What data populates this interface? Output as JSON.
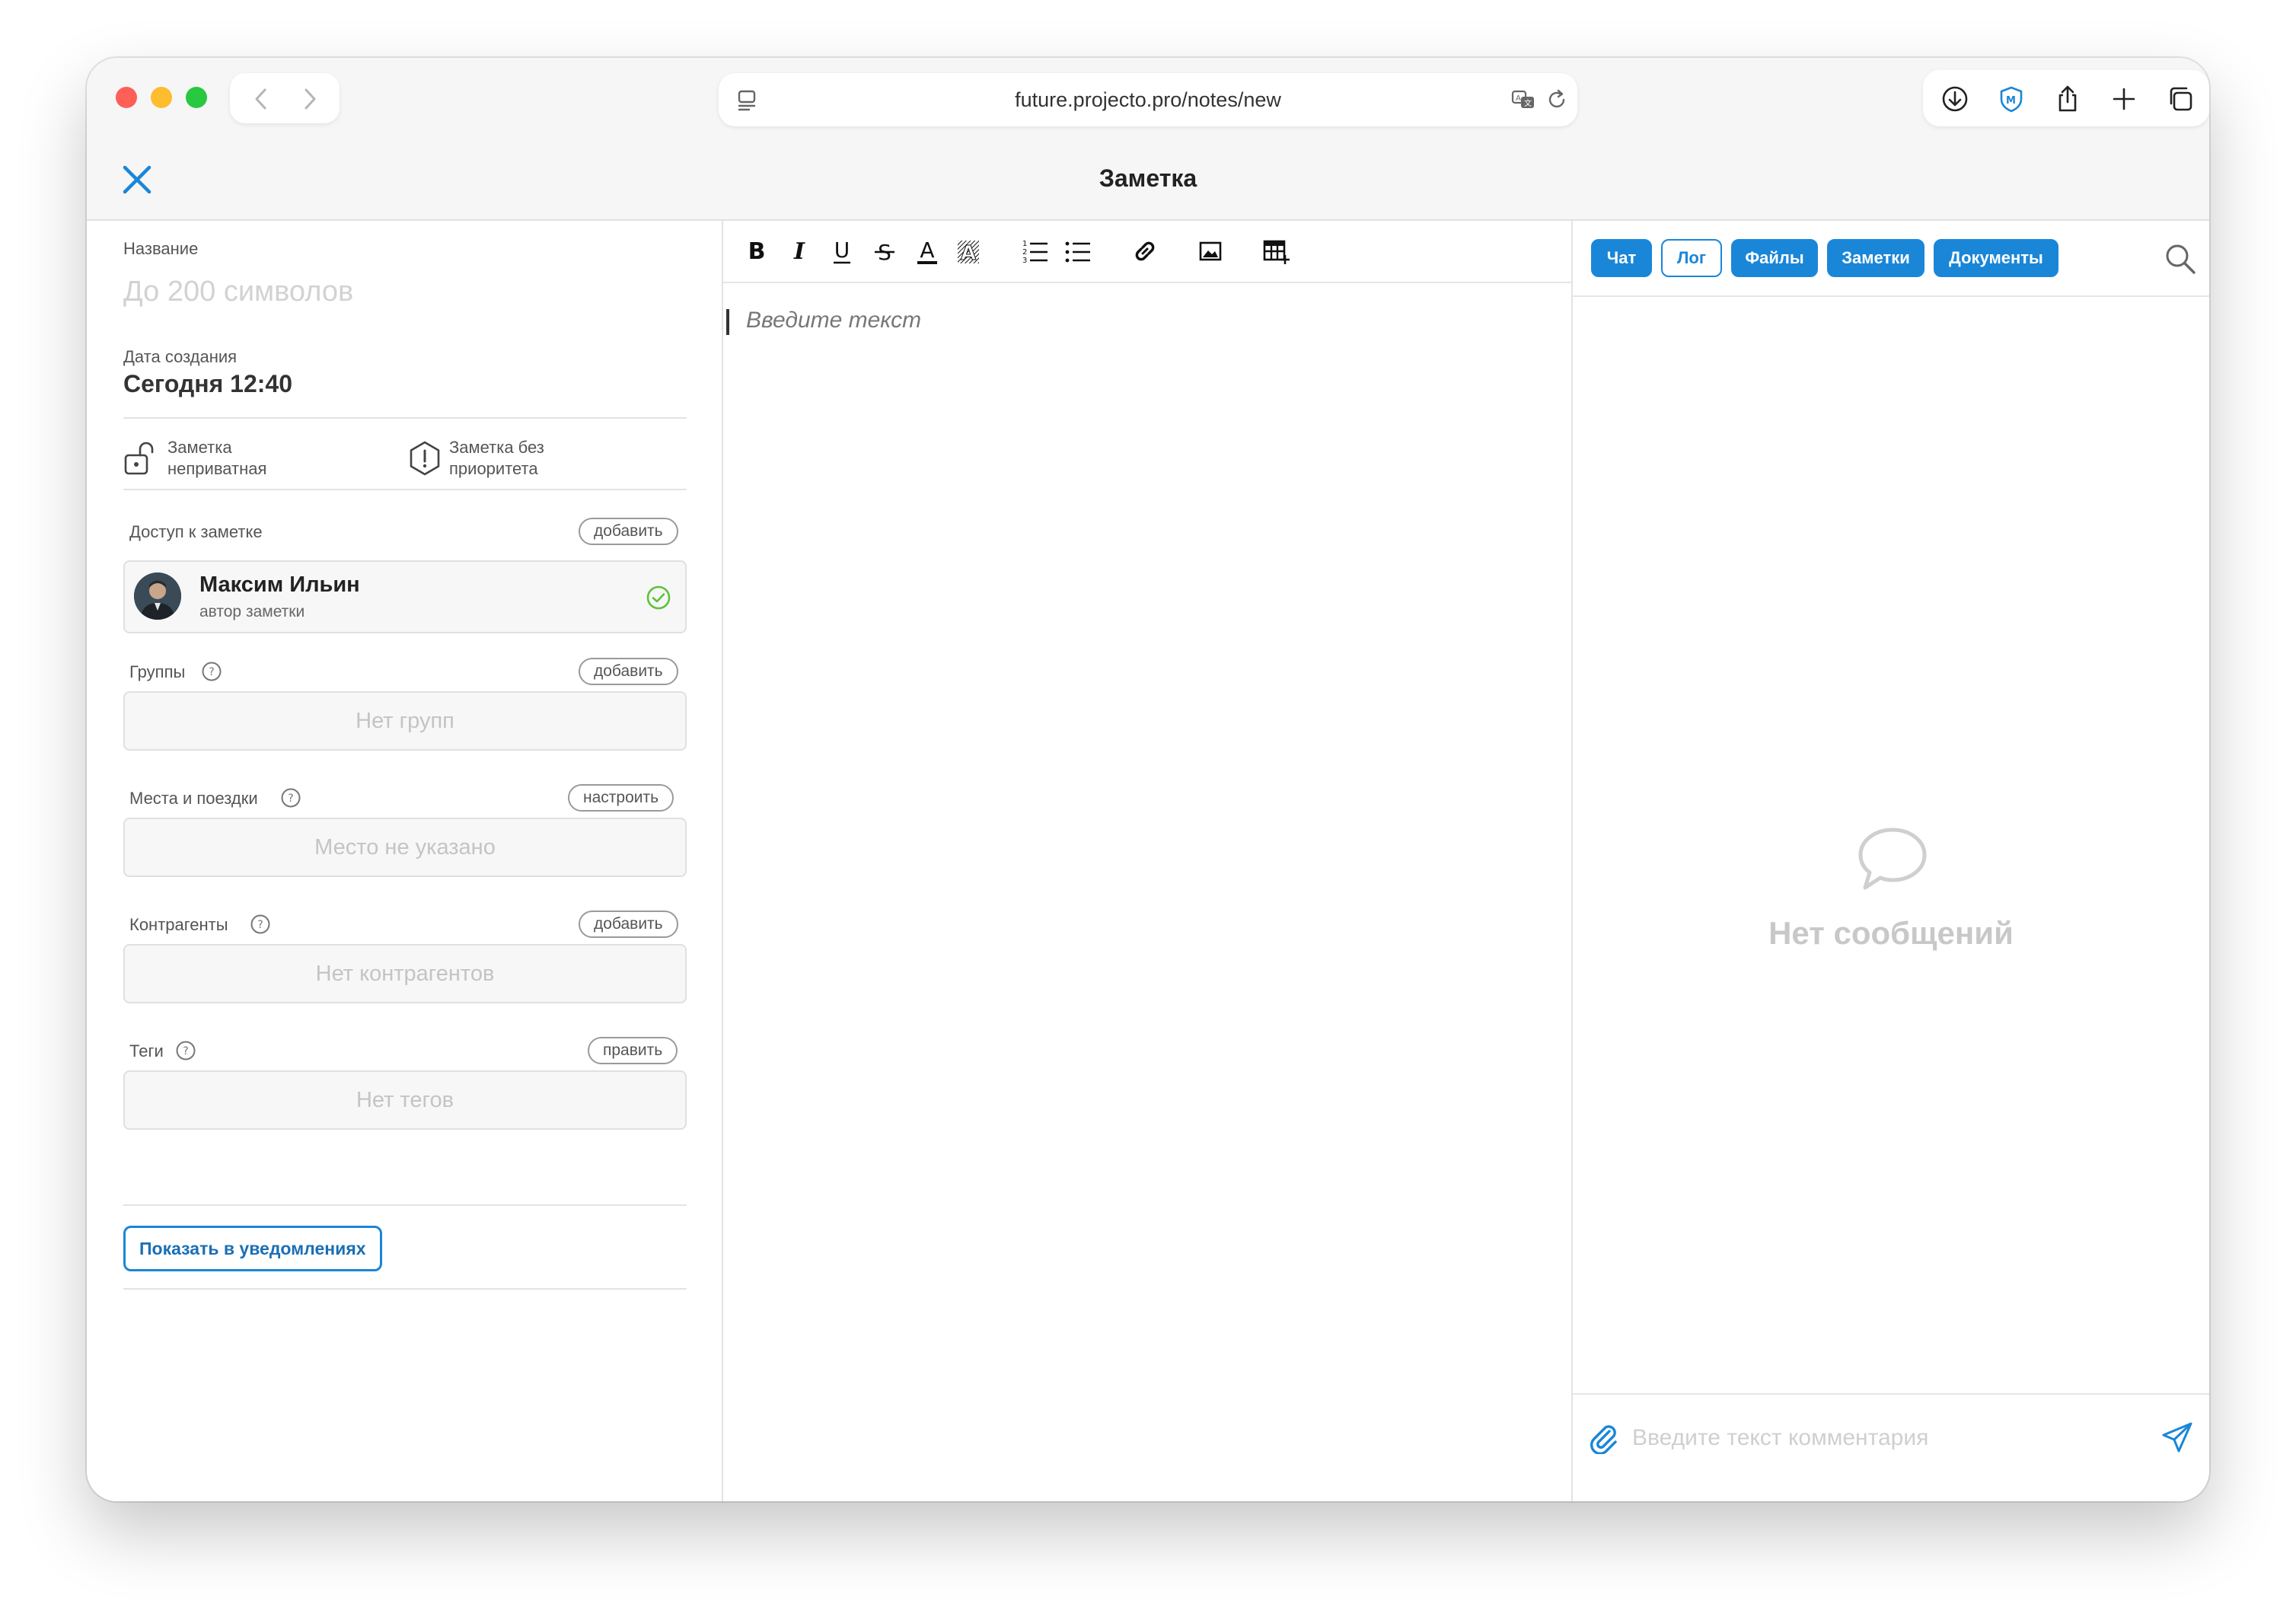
{
  "browser": {
    "url": "future.projecto.pro/notes/new"
  },
  "header": {
    "title": "Заметка"
  },
  "left": {
    "name_label": "Название",
    "name_placeholder": "До 200 символов",
    "created_label": "Дата создания",
    "created_value": "Сегодня 12:40",
    "privacy": {
      "line1": "Заметка",
      "line2": "неприватная"
    },
    "priority": {
      "line1": "Заметка без",
      "line2": "приоритета"
    },
    "access": {
      "label": "Доступ к заметке",
      "button": "добавить",
      "user_name": "Максим Ильин",
      "user_role": "автор заметки"
    },
    "groups": {
      "label": "Группы",
      "button": "добавить",
      "empty": "Нет групп"
    },
    "places": {
      "label": "Места и поездки",
      "button": "настроить",
      "empty": "Место не указано"
    },
    "counterparties": {
      "label": "Контрагенты",
      "button": "добавить",
      "empty": "Нет контрагентов"
    },
    "tags": {
      "label": "Теги",
      "button": "править",
      "empty": "Нет тегов"
    },
    "notify_button": "Показать в уведомлениях"
  },
  "editor": {
    "placeholder": "Введите текст"
  },
  "right": {
    "tabs": [
      {
        "label": "Чат"
      },
      {
        "label": "Лог"
      },
      {
        "label": "Файлы"
      },
      {
        "label": "Заметки"
      },
      {
        "label": "Документы"
      }
    ],
    "empty_text": "Нет сообщений",
    "comment_placeholder": "Введите текст комментария"
  },
  "colors": {
    "accent": "#1a86d8",
    "success": "#5cc23a",
    "muted": "#c4c4c4"
  }
}
